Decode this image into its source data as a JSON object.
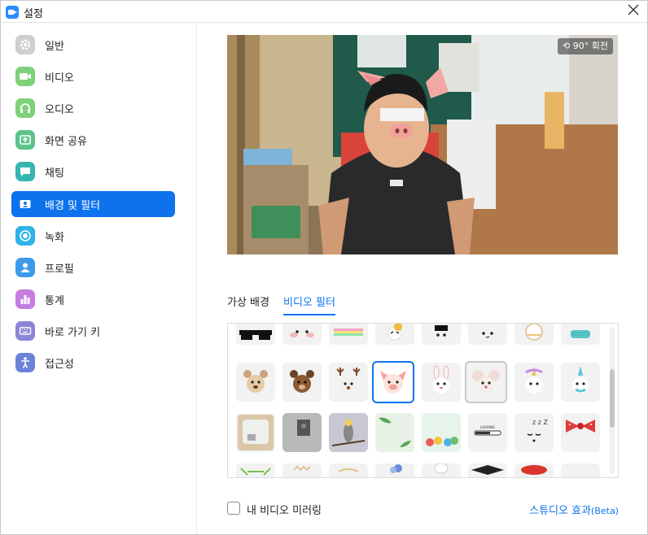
{
  "window": {
    "title": "설정"
  },
  "sidebar": {
    "items": [
      {
        "label": "일반",
        "icon": "gear-icon",
        "color": "#bdbdbd",
        "active": false
      },
      {
        "label": "비디오",
        "icon": "video-camera-icon",
        "color": "#7ed17a",
        "active": false
      },
      {
        "label": "오디오",
        "icon": "headphones-icon",
        "color": "#7ed17a",
        "active": false
      },
      {
        "label": "화면 공유",
        "icon": "share-screen-icon",
        "color": "#5cc28a",
        "active": false
      },
      {
        "label": "채팅",
        "icon": "chat-bubble-icon",
        "color": "#37b6b0",
        "active": false
      },
      {
        "label": "배경 및 필터",
        "icon": "background-icon",
        "color": "#0e72ed",
        "active": true
      },
      {
        "label": "녹화",
        "icon": "record-icon",
        "color": "#2db3e6",
        "active": false
      },
      {
        "label": "프로필",
        "icon": "profile-icon",
        "color": "#3d9ae8",
        "active": false
      },
      {
        "label": "통계",
        "icon": "statistics-icon",
        "color": "#c57de0",
        "active": false
      },
      {
        "label": "바로 가기 키",
        "icon": "keyboard-icon",
        "color": "#8a86d6",
        "active": false
      },
      {
        "label": "접근성",
        "icon": "accessibility-icon",
        "color": "#6a82d8",
        "active": false
      }
    ]
  },
  "preview": {
    "rotate_label": "90° 회전"
  },
  "tabs": [
    {
      "label": "가상 배경",
      "active": false
    },
    {
      "label": "비디오 필터",
      "active": true
    }
  ],
  "filters": {
    "rows": [
      [
        "sunglasses",
        "blush",
        "rainbow",
        "crown",
        "bow-tie",
        "blush-face",
        "mask",
        "medical-mask"
      ],
      [
        "puppy",
        "bear",
        "reindeer",
        "pig",
        "bunny",
        "mouse",
        "unicorn",
        "unicorn-blue"
      ],
      [
        "tv-frame",
        "room-frame",
        "bird",
        "leaves",
        "confetti",
        "loading-bar",
        "sleepy",
        "red-bow"
      ],
      [
        "glasses",
        "tiara",
        "crown-gold",
        "flower",
        "chef-hat",
        "grad-cap",
        "beret",
        "blank"
      ]
    ],
    "selected": "pig"
  },
  "footer": {
    "mirror_label": "내 비디오 미러링",
    "studio_label": "스튜디오 효과",
    "studio_beta": "(Beta)"
  },
  "colors": {
    "accent": "#0e72ed"
  }
}
